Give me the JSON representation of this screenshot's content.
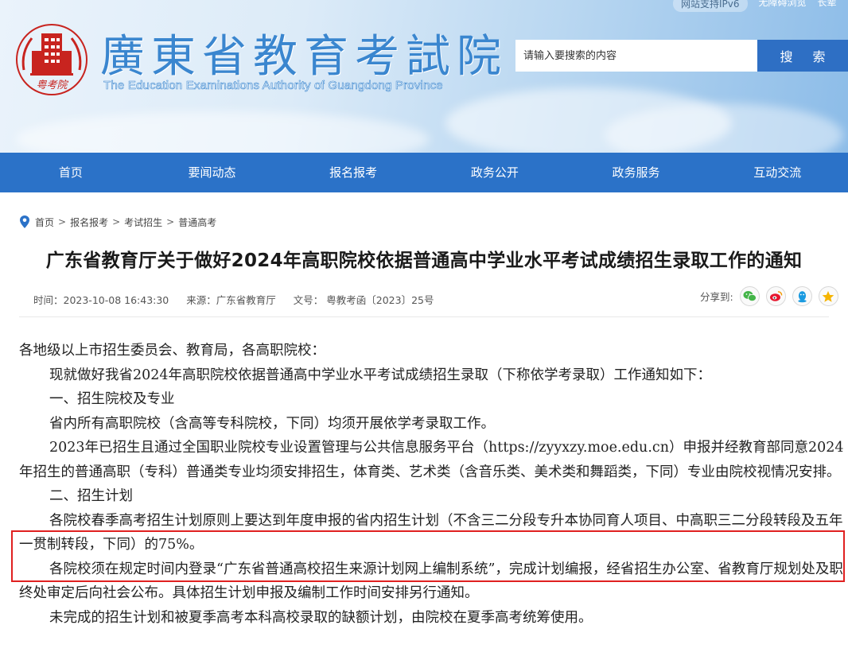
{
  "header": {
    "logo_caption": "粤考院",
    "site_title": "廣東省教育考試院",
    "site_subtitle": "The Education Examinations Authority of Guangdong Province",
    "top_links": [
      "网站支持IPv6",
      "无障碍浏览",
      "长辈"
    ],
    "search": {
      "placeholder": "请输入要搜索的内容",
      "button": "搜 索"
    }
  },
  "nav": {
    "items": [
      "首页",
      "要闻动态",
      "报名报考",
      "政务公开",
      "政务服务",
      "互动交流"
    ]
  },
  "breadcrumb": [
    "首页",
    "报名报考",
    "考试招生",
    "普通高考"
  ],
  "article": {
    "title": "广东省教育厅关于做好2024年高职院校依据普通高中学业水平考试成绩招生录取工作的通知",
    "time": "时间：2023-10-08 16:43:30",
    "source": "来源：广东省教育厅",
    "doc_no": "文号： 粤教考函〔2023〕25号",
    "share_label": "分享到:",
    "share_icons": [
      "wechat-icon",
      "weibo-icon",
      "qq-icon",
      "qzone-icon"
    ],
    "paragraphs": [
      "各地级以上市招生委员会、教育局，各高职院校：",
      "现就做好我省2024年高职院校依据普通高中学业水平考试成绩招生录取（下称依学考录取）工作通知如下：",
      "一、招生院校及专业",
      "省内所有高职院校（含高等专科院校，下同）均须开展依学考录取工作。",
      "2023年已招生且通过全国职业院校专业设置管理与公共信息服务平台（https://zyyxzy.moe.edu.cn）申报并经教育部同意2024年招生的普通高职（专科）普通类专业均须安排招生，体育类、艺术类（含音乐类、美术类和舞蹈类，下同）专业由院校视情况安排。",
      "二、招生计划",
      "各院校春季高考招生计划原则上要达到年度申报的省内招生计划（不含三二分段专升本协同育人项目、中高职三二分段转段及五年一贯制转段，下同）的75%。",
      "各院校须在规定时间内登录“广东省普通高校招生来源计划网上编制系统”，完成计划编报，经省招生办公室、省教育厅规划处及职终处审定后向社会公布。具体招生计划申报及编制工作时间安排另行通知。",
      "未完成的招生计划和被夏季高考本科高校录取的缺额计划，由院校在夏季高考统筹使用。"
    ]
  },
  "colors": {
    "nav_bg": "#2b72c8",
    "search_btn": "#2e6fc4",
    "title_blue": "#3a86cf",
    "highlight": "#e02020",
    "logo_red": "#c8241f"
  }
}
